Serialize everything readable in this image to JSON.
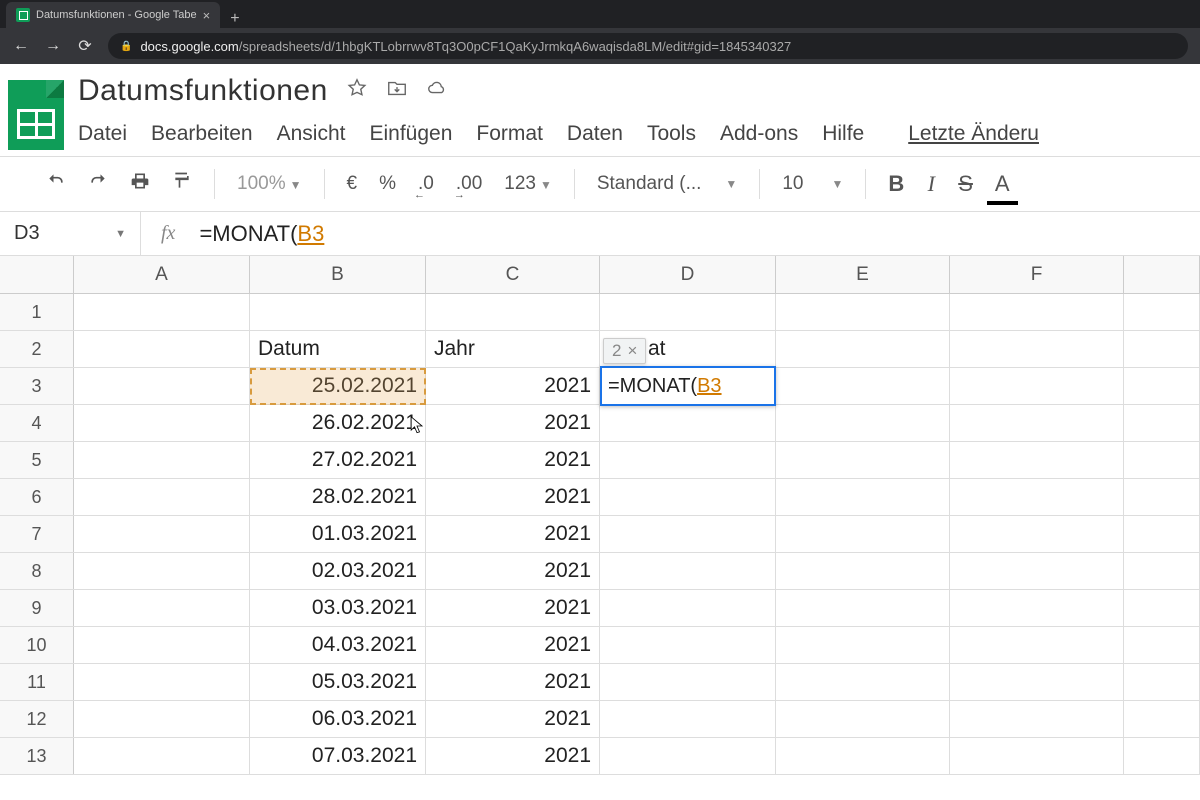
{
  "browser": {
    "tab_title": "Datumsfunktionen - Google Tabe",
    "url_prefix": "docs.google.com",
    "url_rest": "/spreadsheets/d/1hbgKTLobrrwv8Tq3O0pCF1QaKyJrmkqA6waqisda8LM/edit#gid=1845340327"
  },
  "doc": {
    "title": "Datumsfunktionen",
    "menu": [
      "Datei",
      "Bearbeiten",
      "Ansicht",
      "Einfügen",
      "Format",
      "Daten",
      "Tools",
      "Add-ons",
      "Hilfe"
    ],
    "last_edit": "Letzte Änderu"
  },
  "toolbar": {
    "zoom": "100%",
    "currency": "€",
    "percent": "%",
    "dec_less": ".0",
    "dec_more": ".00",
    "numfmt": "123",
    "font": "Standard (...",
    "font_size": "10",
    "bold": "B",
    "italic": "I",
    "strike": "S",
    "textcolor": "A"
  },
  "fx": {
    "name_box": "D3",
    "label": "fx",
    "formula_plain": "=MONAT(",
    "formula_ref": "B3"
  },
  "columns": [
    "A",
    "B",
    "C",
    "D",
    "E",
    "F"
  ],
  "headers": {
    "B": "Datum",
    "C": "Jahr",
    "D_partial": "at"
  },
  "rows": [
    {
      "n": 1
    },
    {
      "n": 2
    },
    {
      "n": 3,
      "B": "25.02.2021",
      "C": "2021"
    },
    {
      "n": 4,
      "B": "26.02.2021",
      "C": "2021"
    },
    {
      "n": 5,
      "B": "27.02.2021",
      "C": "2021"
    },
    {
      "n": 6,
      "B": "28.02.2021",
      "C": "2021"
    },
    {
      "n": 7,
      "B": "01.03.2021",
      "C": "2021"
    },
    {
      "n": 8,
      "B": "02.03.2021",
      "C": "2021"
    },
    {
      "n": 9,
      "B": "03.03.2021",
      "C": "2021"
    },
    {
      "n": 10,
      "B": "04.03.2021",
      "C": "2021"
    },
    {
      "n": 11,
      "B": "05.03.2021",
      "C": "2021"
    },
    {
      "n": 12,
      "B": "06.03.2021",
      "C": "2021"
    },
    {
      "n": 13,
      "B": "07.03.2021",
      "C": "2021"
    }
  ],
  "active_cell": {
    "formula_plain": "=MONAT(",
    "formula_ref": "B3",
    "hint_value": "2",
    "hint_close": "×"
  }
}
